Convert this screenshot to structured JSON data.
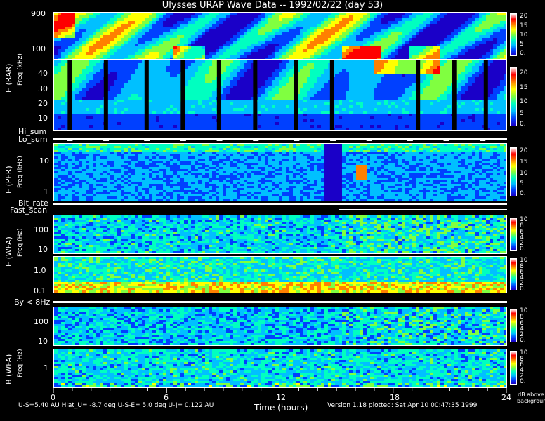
{
  "title": "Ulysses URAP Wave Data -- 1992/02/22  (day 53)",
  "x_axis": {
    "label": "Time (hours)",
    "ticks": [
      "0",
      "6",
      "12",
      "18",
      "24"
    ]
  },
  "panels": {
    "rar": {
      "label": "E (RAR)",
      "freq_label": "Freq (kHz)",
      "ticks": [
        "900",
        "100"
      ],
      "cbar": [
        "20",
        "15",
        "10",
        "5",
        "0."
      ]
    },
    "rar_low": {
      "ticks": [
        "40",
        "30",
        "20",
        "10"
      ],
      "cbar": [
        "20",
        "15",
        "10",
        "5",
        "0."
      ]
    },
    "pfr": {
      "label": "E (PFR)",
      "freq_label": "Freq (kHz)",
      "ticks": [
        "10",
        "1"
      ],
      "cbar": [
        "20",
        "15",
        "10",
        "5",
        "0."
      ]
    },
    "wfa_e": {
      "label": "E (WFA)",
      "freq_label": "Freq (Hz)",
      "ticks": [
        "100",
        "10"
      ],
      "cbar": [
        "10",
        "8",
        "6",
        "4",
        "2",
        "0."
      ]
    },
    "wfa_e_low": {
      "ticks": [
        "1.0",
        "0.1"
      ],
      "cbar": [
        "10",
        "8",
        "6",
        "4",
        "2",
        "0."
      ]
    },
    "wfa_b": {
      "label": "B (WFA)",
      "freq_label": "Freq (Hz)",
      "ticks": [
        "100",
        "10"
      ],
      "cbar": [
        "10",
        "8",
        "6",
        "4",
        "2",
        "0."
      ]
    },
    "wfa_b_low": {
      "ticks": [
        "1"
      ],
      "cbar": [
        "10",
        "8",
        "6",
        "4",
        "2",
        "0."
      ]
    }
  },
  "strips": {
    "hi_sum": "Hi_sum",
    "lo_sum": "Lo_sum",
    "bit_rate": "Bit_rate",
    "fast_scan": "Fast_scan",
    "by": "By < 8Hz"
  },
  "cbar_units": "dB above background",
  "footer": {
    "left": "U-S=5.40 AU  Hlat_U= -8.7 deg  U-S-E=  5.0 deg  U-J= 0.122 AU",
    "right": "Version 1.18 plotted: Sat Apr 10 00:47:35 1999"
  },
  "colors": {
    "bg": "#000000",
    "fg": "#ffffff"
  },
  "chart_data": {
    "type": "heatmap",
    "title": "Ulysses URAP Wave Data -- 1992/02/22  (day 53)",
    "xlabel": "Time (hours)",
    "xlim": [
      0,
      24
    ],
    "colorscale": [
      "#1a00c8",
      "#0040ff",
      "#00c0ff",
      "#00ffc0",
      "#80ff40",
      "#ffff00",
      "#ff8000",
      "#ff0000",
      "#ffffff"
    ],
    "series": [
      {
        "name": "E (RAR)",
        "ylabel": "Freq (kHz)",
        "zlim": [
          0,
          20
        ],
        "x": [
          0,
          2,
          4,
          6,
          8,
          10,
          12,
          14,
          16,
          18,
          20,
          22,
          24
        ],
        "rows": [
          [
            0.7,
            0.4,
            0.5,
            0.5,
            0.6,
            0.4,
            0.5,
            0.5,
            0.6,
            0.5,
            0.5,
            0.5,
            0.6
          ],
          [
            0.6,
            0.5,
            0.5,
            0.6,
            0.6,
            0.5,
            0.6,
            0.6,
            0.7,
            0.6,
            0.6,
            0.5,
            0.5
          ],
          [
            0.8,
            0.5,
            0.6,
            0.9,
            0.7,
            0.5,
            0.5,
            0.6,
            0.9,
            0.8,
            0.6,
            0.5,
            0.4
          ]
        ]
      },
      {
        "name": "E (PFR)",
        "ylabel": "Freq (kHz)",
        "zlim": [
          0,
          20
        ],
        "x": [
          0,
          2,
          4,
          6,
          8,
          10,
          12,
          14,
          16,
          18,
          20,
          22,
          24
        ],
        "rows": [
          [
            0.3,
            0.3,
            0.3,
            0.3,
            0.3,
            0.3,
            0.3,
            0.1,
            0.3,
            0.3,
            0.3,
            0.3,
            0.3
          ],
          [
            0.4,
            0.5,
            0.4,
            0.4,
            0.4,
            0.4,
            0.4,
            0.1,
            0.6,
            0.4,
            0.3,
            0.3,
            0.4
          ],
          [
            0.3,
            0.4,
            0.3,
            0.3,
            0.3,
            0.3,
            0.3,
            0.1,
            0.8,
            0.3,
            0.3,
            0.3,
            0.3
          ]
        ]
      },
      {
        "name": "E (WFA)",
        "ylabel": "Freq (Hz)",
        "zlim": [
          0,
          10
        ],
        "x": [
          0,
          2,
          4,
          6,
          8,
          10,
          12,
          14,
          16,
          18,
          20,
          22,
          24
        ],
        "rows": [
          [
            0.4,
            0.3,
            0.3,
            0.4,
            0.3,
            0.4,
            0.3,
            0.3,
            0.4,
            0.4,
            0.4,
            0.3,
            0.3
          ],
          [
            0.6,
            0.5,
            0.5,
            0.5,
            0.6,
            0.5,
            0.5,
            0.6,
            0.5,
            0.5,
            0.6,
            0.5,
            0.5
          ]
        ]
      },
      {
        "name": "B (WFA)",
        "ylabel": "Freq (Hz)",
        "zlim": [
          0,
          10
        ],
        "x": [
          0,
          2,
          4,
          6,
          8,
          10,
          12,
          14,
          16,
          18,
          20,
          22,
          24
        ],
        "rows": [
          [
            0.3,
            0.3,
            0.3,
            0.3,
            0.3,
            0.3,
            0.3,
            0.3,
            0.4,
            0.4,
            0.4,
            0.4,
            0.3
          ],
          [
            0.4,
            0.4,
            0.4,
            0.5,
            0.4,
            0.4,
            0.4,
            0.4,
            0.4,
            0.4,
            0.4,
            0.4,
            0.4
          ]
        ]
      }
    ]
  }
}
